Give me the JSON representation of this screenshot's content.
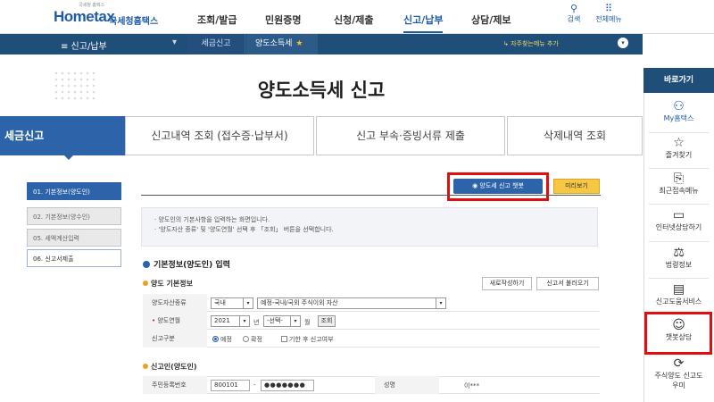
{
  "header": {
    "logo_small": "국세청 홈택스",
    "logo": "Hometax",
    "logo_kr": "국세청홈택스",
    "nav": [
      "조회/발급",
      "민원증명",
      "신청/제출",
      "신고/납부",
      "상담/제보"
    ],
    "active_nav": "신고/납부",
    "search_label": "검색",
    "allmenu_label": "전체메뉴"
  },
  "crumb": {
    "menu": "≡  신고/납부",
    "tab_a": "세금신고",
    "tab_b": "양도소득세",
    "notice": "↳ 자주찾는메뉴 추가"
  },
  "title": "양도소득세 신고",
  "tabs": {
    "t1": "세금신고",
    "t2": "신고내역 조회 (접수증·납부서)",
    "t3": "신고 부속·증빙서류 제출",
    "t4": "삭제내역 조회"
  },
  "steps": [
    "01. 기본정보(양도인)",
    "02. 기본정보(양수인)",
    "05. 세액계산입력",
    "06. 신고서제출"
  ],
  "buttons": {
    "contact": "양도세 신고 챗봇",
    "preview": "미리보기",
    "new_write": "새로작성하기",
    "load": "신고서 불러오기",
    "query": "조회"
  },
  "info": [
    "· 양도인의 기본사항을 입력하는 화면입니다.",
    "· '양도자산 종류' 및 '양도연월' 선택 후 「조회」 버튼을 선택합니다."
  ],
  "section_title": "기본정보(양도인) 입력",
  "subsection1": "양도 기본정보",
  "form": {
    "asset_label": "양도자산종류",
    "asset_sel1": "국내",
    "asset_sel2": "예정-국내/국외 주식이외 자산",
    "date_label": "양도연월",
    "year": "2021",
    "year_suffix": "년",
    "month": "-선택-",
    "month_suffix": "월",
    "type_label": "신고구분",
    "type_opt1": "예정",
    "type_opt2": "확정",
    "type_opt3": "기한 후 신고여부"
  },
  "subsection2": "신고인(양도인)",
  "resident": {
    "label": "주민등록번호",
    "front": "800101",
    "dash": "-",
    "back": "●●●●●●●",
    "name_label": "성명",
    "name": "이***"
  },
  "quick": {
    "head": "바로가기",
    "items": [
      {
        "icon": "person",
        "label": "My홈택스"
      },
      {
        "icon": "star",
        "label": "즐겨찾기"
      },
      {
        "icon": "recent",
        "label": "최근접속메뉴"
      },
      {
        "icon": "monitor",
        "label": "인터넷상담하기"
      },
      {
        "icon": "law",
        "label": "법령정보"
      },
      {
        "icon": "book",
        "label": "신고도움서비스"
      },
      {
        "icon": "chat",
        "label": "챗봇상담"
      },
      {
        "icon": "stock",
        "label": "주식양도 신고도우미"
      }
    ]
  },
  "colors": {
    "primary": "#2d63a8",
    "dark_bar": "#1f4e79",
    "highlight": "#e20d0d",
    "preview_btn": "#f7c744"
  }
}
